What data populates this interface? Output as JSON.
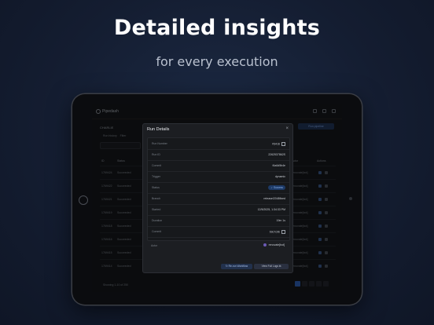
{
  "headline": "Detailed insights",
  "subline": "for every execution",
  "app": {
    "name": "Pipedash",
    "sub_title": "CHARLIE",
    "action_label": "Run pipeline",
    "filters": [
      "Run history",
      "Filter"
    ],
    "columns": [
      "ID",
      "Status",
      "Actor",
      "Actions"
    ],
    "rows": [
      {
        "id": "1769424",
        "status": "Succeeded",
        "actor": "renovate[bot]"
      },
      {
        "id": "1769422",
        "status": "Succeeded",
        "actor": "renovate[bot]"
      },
      {
        "id": "1769421",
        "status": "Succeeded",
        "actor": "renovate[bot]"
      },
      {
        "id": "1769419",
        "status": "Succeeded",
        "actor": "renovate[bot]"
      },
      {
        "id": "1769418",
        "status": "Succeeded",
        "actor": "renovate[bot]"
      },
      {
        "id": "1769416",
        "status": "Succeeded",
        "actor": "renovate[bot]"
      },
      {
        "id": "1769415",
        "status": "Succeeded",
        "actor": "renovate[bot]"
      },
      {
        "id": "1769414",
        "status": "Succeeded",
        "actor": "renovate[bot]"
      }
    ],
    "footer": "Showing 1-10 of 250",
    "pages": [
      "1",
      "2",
      "3",
      "4",
      "5"
    ]
  },
  "modal": {
    "title": "Run Details",
    "close": "×",
    "fields": [
      {
        "label": "Run Number",
        "value": "#3416"
      },
      {
        "label": "Run ID",
        "value": "2262537862S"
      },
      {
        "label": "Commit",
        "value": "f4a6d5b4e"
      },
      {
        "label": "Trigger",
        "value": "dynamic"
      },
      {
        "label": "Status",
        "value": "Success"
      },
      {
        "label": "Branch",
        "value": "release/2048fixed"
      },
      {
        "label": "Started",
        "value": "12/5/2025, 1:34:33 PM"
      },
      {
        "label": "Duration",
        "value": "19m 1s"
      },
      {
        "label": "Commit",
        "value": "69c7c9b"
      },
      {
        "label": "Actor",
        "value": "renovate[bot]"
      }
    ],
    "rerun_label": "Re-run Workflow",
    "logs_label": "View Full Logs"
  }
}
